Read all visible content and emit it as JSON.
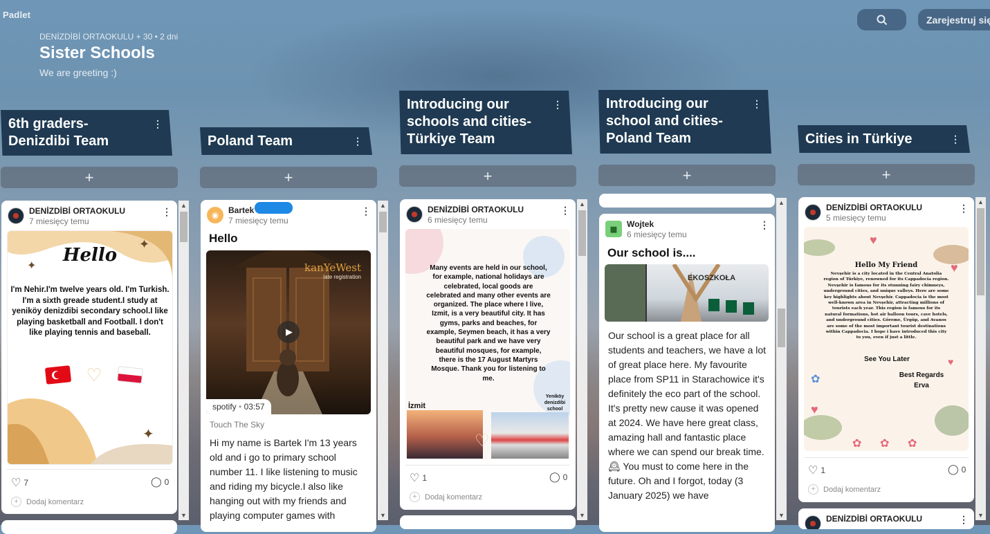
{
  "app": {
    "logo": "Padlet"
  },
  "header": {
    "meta": "DENİZDİBİ ORTAOKULU + 30 • 2 dni",
    "title": "Sister Schools",
    "subtitle": "We are greeting :)",
    "register_label": "Zarejestruj się"
  },
  "columns": [
    {
      "title": "6th graders- Denizdibi Team"
    },
    {
      "title": "Poland Team"
    },
    {
      "title": "Introducing our schools and cities- Türkiye Team"
    },
    {
      "title": "Introducing our school and cities- Poland Team"
    },
    {
      "title": "Cities in Türkiye"
    }
  ],
  "add_label": "+",
  "add_comment_label": "Dodaj komentarz",
  "posts": {
    "c1": {
      "author": "DENİZDİBİ ORTAOKULU",
      "time": "7 miesięcy temu",
      "image_heading": "Hello",
      "image_text": "I'm Nehir.I'm twelve years old. I'm Turkish. I'm a sixth greade student.I study at yeniköy denizdibi secondary school.I like playing basketball and Football. I don't like playing tennis and baseball.",
      "likes": "7",
      "comments": "0"
    },
    "c2": {
      "author": "Bartek",
      "time": "7 miesięcy temu",
      "title": "Hello",
      "album_artist": "kanYeWest",
      "album_sub": "late registration",
      "source": "spotify",
      "duration": "03:57",
      "track": "Touch The Sky",
      "body": "Hi my name is Bartek I'm 13 years old and i go to primary school number 11. I like listening to music and riding my bicycle.I also like hanging out with my friends and playing computer games with"
    },
    "c3": {
      "author": "DENİZDİBİ ORTAOKULU",
      "time": "6 miesięcy temu",
      "image_text": "Many events are held in our school, for example, national holidays are celebrated, local goods are celebrated and many other events are organized. The place where I live, Izmit, is a very beautiful city. It has gyms, parks and beaches, for example, Seymen beach, it has a very beautiful park and we have very beautiful mosques, for example, there is the 17 August Martyrs Mosque. Thank you for listening to me.",
      "label_left": "İzmit",
      "label_right": "Yeniköy denizdibi school",
      "likes": "1",
      "comments": "0"
    },
    "c4": {
      "author": "Wojtek",
      "time": "6 miesięcy temu",
      "title": "Our school is....",
      "sign_text": "EKOSZKOŁA",
      "body": "Our school is a great place for all students and teachers, we have a lot of great place here. My favourite place from SP11 in Starachowice it's definitely the eco part of the school. It's pretty new cause it was opened at 2024. We have here great class, amazing hall and fantastic place where we can spend our break time. 🕰 You must to come here in the future. Oh and I forgot, today (3 January 2025) we have"
    },
    "c5": {
      "author": "DENİZDİBİ ORTAOKULU",
      "time": "5 miesięcy temu",
      "image_heading": "Hello My Friend",
      "image_text": "Nevşehir is a city located in the Central Anatolia region of Türkiye, renowned for its Cappadocia region. Nevşehir is famous for its stunning fairy chimneys, underground cities, and unique valleys. Here are some key highlights about Nevşehir. Cappadocia is the most well-known area in Nevşehir, attracting millions of tourists each year. This region is famous for its natural formations, hot air balloon tours, cave hotels, and underground cities. Göreme, Ürgüp, and Avanos are some of the most important tourist destinations within Cappadocia. I hope i have introduced this city to you, even if just a little.",
      "see_you": "See You Later",
      "regards": "Best Regards",
      "signature": "Erva",
      "likes": "1",
      "comments": "0",
      "next_author": "DENİZDİBİ ORTAOKULU"
    }
  },
  "colors": {
    "column_header": "#1f3a52",
    "card": "#ffffff"
  }
}
